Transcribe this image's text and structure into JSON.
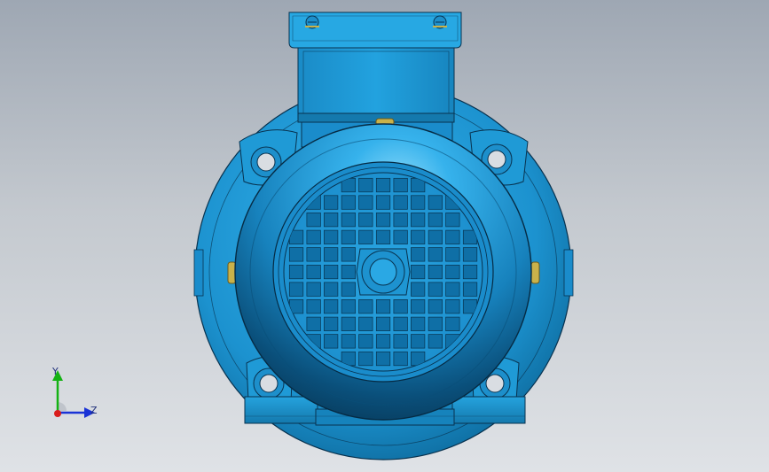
{
  "viewer": {
    "triad": {
      "y_label": "Y",
      "z_label": "Z",
      "y_color": "#14b214",
      "z_color": "#1a33d6",
      "origin_color": "#d91c1c"
    }
  },
  "model": {
    "part": "electric-motor",
    "view": "rear",
    "body_color": "#1c9ad6",
    "dark_color": "#0a4f78",
    "highlight_color": "#7fd2f7",
    "edge_color": "#08324f",
    "brass_color": "#c9b24a"
  }
}
